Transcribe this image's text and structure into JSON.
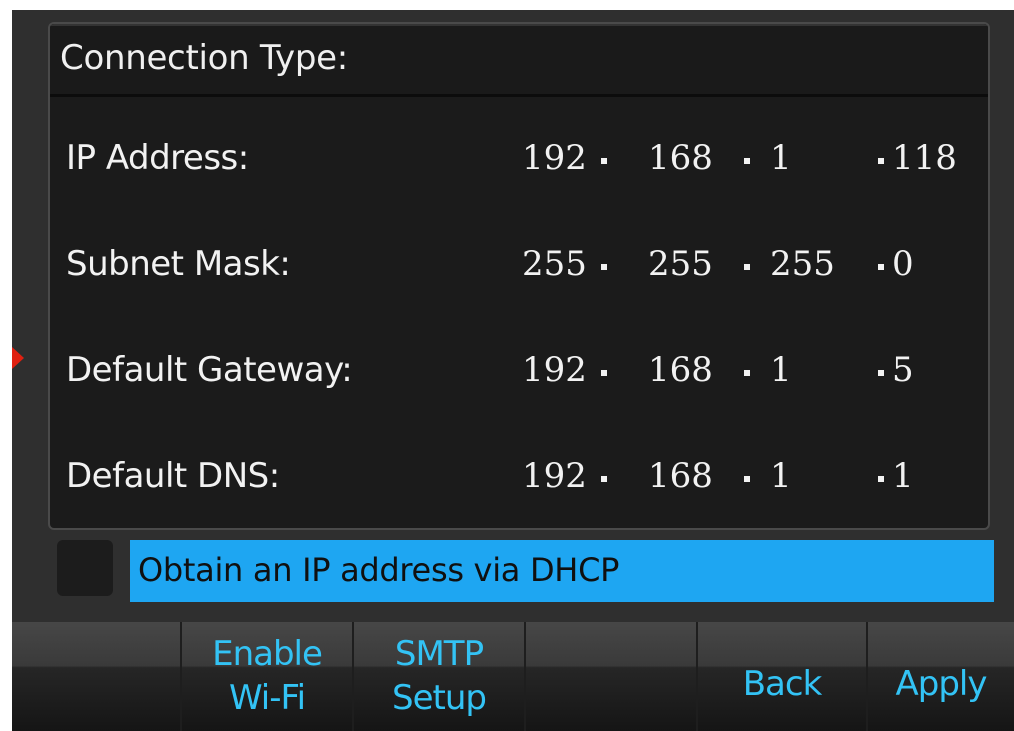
{
  "panel": {
    "title": "Connection Type:",
    "rows": [
      {
        "label": "IP Address:",
        "octets": [
          "192",
          "168",
          "1",
          "118"
        ]
      },
      {
        "label": "Subnet Mask:",
        "octets": [
          "255",
          "255",
          "255",
          "0"
        ]
      },
      {
        "label": "Default Gateway:",
        "octets": [
          "192",
          "168",
          "1",
          "5"
        ]
      },
      {
        "label": "Default DNS:",
        "octets": [
          "192",
          "168",
          "1",
          "1"
        ]
      }
    ]
  },
  "dhcp": {
    "label": "Obtain an IP address via DHCP",
    "checked": false
  },
  "softkeys": [
    {
      "line1": "",
      "line2": ""
    },
    {
      "line1": "Enable",
      "line2": "Wi-Fi"
    },
    {
      "line1": "SMTP",
      "line2": "Setup"
    },
    {
      "line1": "",
      "line2": ""
    },
    {
      "line1": "",
      "line2": "Back"
    },
    {
      "line1": "",
      "line2": "Apply"
    }
  ],
  "colors": {
    "accent": "#33c3f5",
    "highlight": "#1ea6f2",
    "background": "#2f2f2f",
    "panel": "#1b1b1b"
  }
}
